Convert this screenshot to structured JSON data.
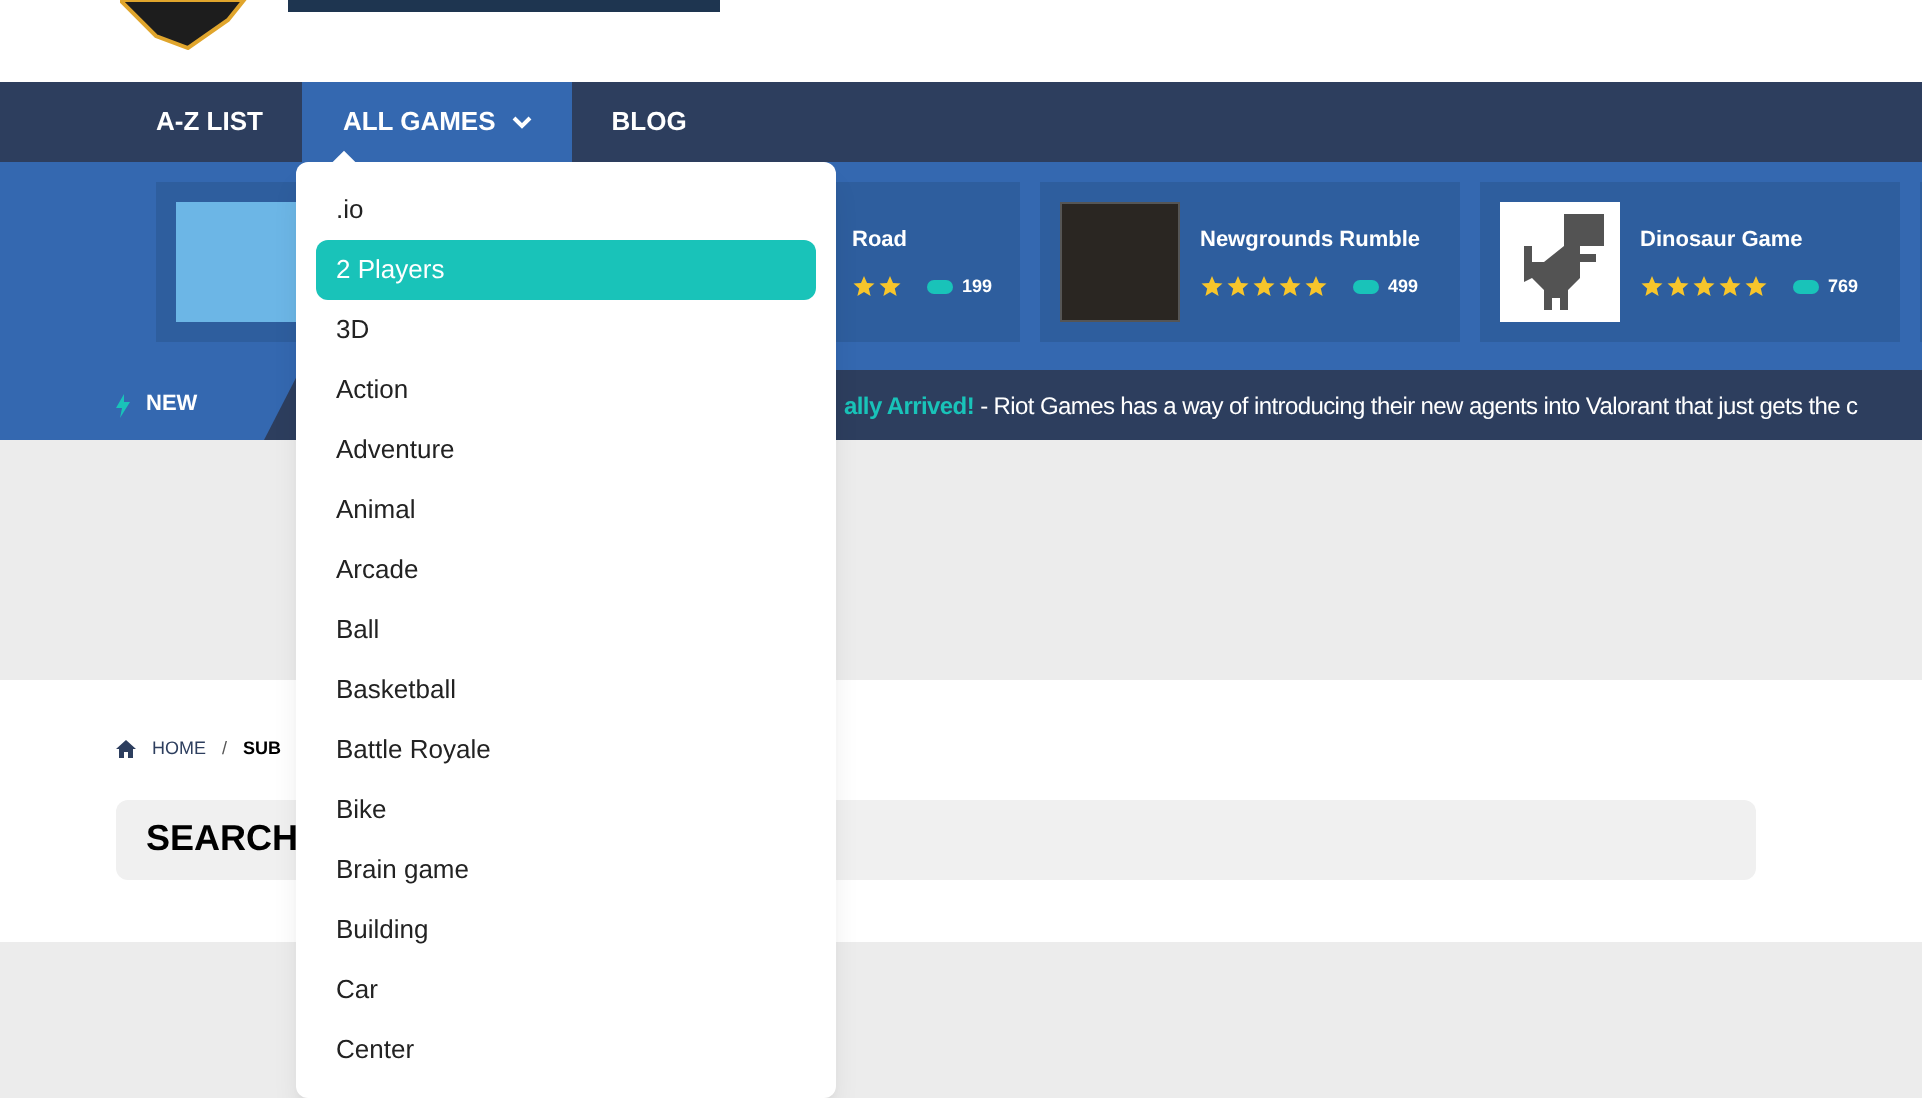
{
  "nav": [
    {
      "label": "A-Z LIST",
      "selected": false,
      "has_menu": false
    },
    {
      "label": "ALL GAMES",
      "selected": true,
      "has_menu": true
    },
    {
      "label": "BLOG",
      "selected": false,
      "has_menu": false
    }
  ],
  "featured": [
    {
      "kind": "image_only"
    },
    {
      "kind": "partial",
      "title": "Road",
      "plays": "199"
    },
    {
      "kind": "poster",
      "title": "Newgrounds Rumble",
      "stars": 5,
      "plays": "499"
    },
    {
      "kind": "dino",
      "title": "Dinosaur Game",
      "stars": 5,
      "plays": "769"
    },
    {
      "kind": "edge"
    }
  ],
  "ticker": {
    "label": "NEW",
    "highlight": "ally Arrived!",
    "text": " - Riot Games has a way of introducing their new agents into Valorant that just gets the c"
  },
  "breadcrumb": [
    {
      "label": "HOME"
    },
    {
      "label": "SUB"
    }
  ],
  "breadcrumb_separator": "/",
  "search_title": "SEARCH",
  "dropdown": [
    {
      "label": ".io",
      "selected": false
    },
    {
      "label": "2 Players",
      "selected": true
    },
    {
      "label": "3D",
      "selected": false
    },
    {
      "label": "Action",
      "selected": false
    },
    {
      "label": "Adventure",
      "selected": false
    },
    {
      "label": "Animal",
      "selected": false
    },
    {
      "label": "Arcade",
      "selected": false
    },
    {
      "label": "Ball",
      "selected": false
    },
    {
      "label": "Basketball",
      "selected": false
    },
    {
      "label": "Battle Royale",
      "selected": false
    },
    {
      "label": "Bike",
      "selected": false
    },
    {
      "label": "Brain game",
      "selected": false
    },
    {
      "label": "Building",
      "selected": false
    },
    {
      "label": "Car",
      "selected": false
    },
    {
      "label": "Center",
      "selected": false
    }
  ]
}
